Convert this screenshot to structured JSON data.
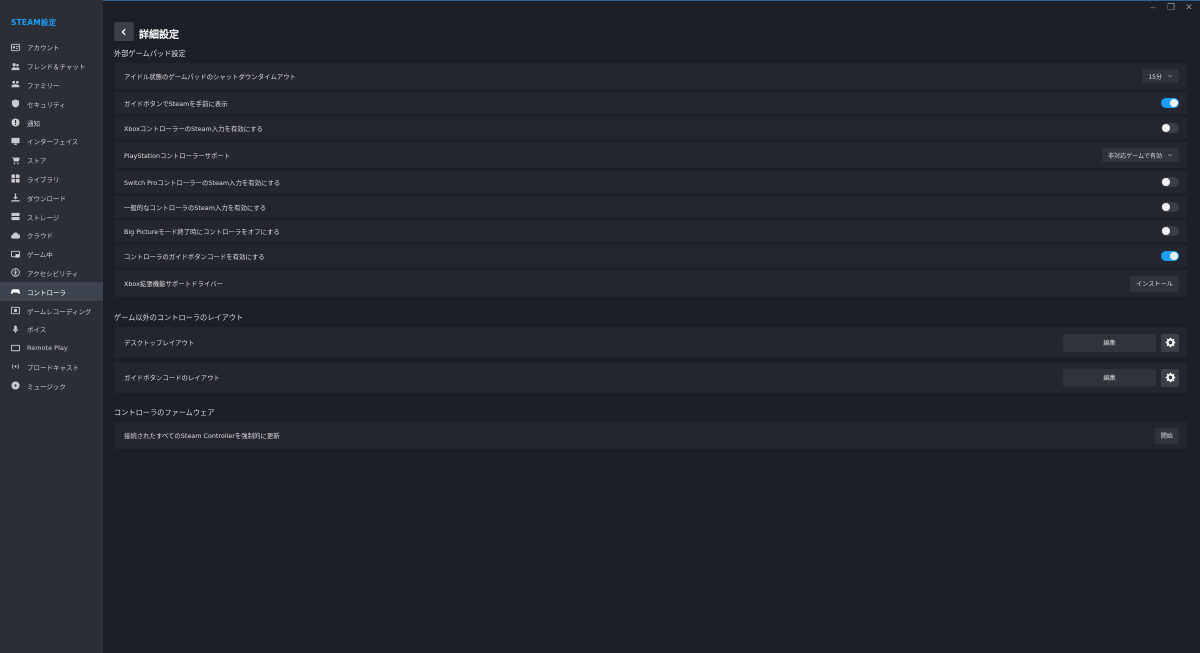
{
  "sidebar": {
    "title": "STEAM設定",
    "items": [
      {
        "label": "アカウント",
        "icon": "account-icon"
      },
      {
        "label": "フレンド＆チャット",
        "icon": "friends-icon"
      },
      {
        "label": "ファミリー",
        "icon": "family-icon"
      },
      {
        "label": "セキュリティ",
        "icon": "shield-icon"
      },
      {
        "label": "通知",
        "icon": "notification-icon"
      },
      {
        "label": "インターフェイス",
        "icon": "monitor-icon"
      },
      {
        "label": "ストア",
        "icon": "cart-icon"
      },
      {
        "label": "ライブラリ",
        "icon": "grid-icon"
      },
      {
        "label": "ダウンロード",
        "icon": "download-icon"
      },
      {
        "label": "ストレージ",
        "icon": "storage-icon"
      },
      {
        "label": "クラウド",
        "icon": "cloud-icon"
      },
      {
        "label": "ゲーム中",
        "icon": "in-game-icon"
      },
      {
        "label": "アクセシビリティ",
        "icon": "accessibility-icon"
      },
      {
        "label": "コントローラ",
        "icon": "gamepad-icon",
        "active": true
      },
      {
        "label": "ゲームレコーディング",
        "icon": "recording-icon"
      },
      {
        "label": "ボイス",
        "icon": "microphone-icon"
      },
      {
        "label": "Remote Play",
        "icon": "remote-play-icon"
      },
      {
        "label": "ブロードキャスト",
        "icon": "broadcast-icon"
      },
      {
        "label": "ミュージック",
        "icon": "music-icon"
      }
    ]
  },
  "header": {
    "title": "詳細設定"
  },
  "sections": {
    "gamepad": {
      "title": "外部ゲームパッド設定",
      "rows": [
        {
          "label": "アイドル状態のゲームパッドのシャットダウンタイムアウト",
          "control": "dropdown",
          "value": "15分"
        },
        {
          "label": "ガイドボタンでSteamを手前に表示",
          "control": "toggle",
          "on": true
        },
        {
          "label": "XboxコントローラーのSteam入力を有効にする",
          "control": "toggle",
          "on": false
        },
        {
          "label": "PlayStationコントローラーサポート",
          "control": "dropdown",
          "value": "非対応ゲームで有効"
        },
        {
          "label": "Switch ProコントローラーのSteam入力を有効にする",
          "control": "toggle",
          "on": false
        },
        {
          "label": "一般的なコントローラのSteam入力を有効にする",
          "control": "toggle",
          "on": false
        },
        {
          "label": "Big Pictureモード終了時にコントローラをオフにする",
          "control": "toggle",
          "on": false
        },
        {
          "label": "コントローラのガイドボタンコードを有効にする",
          "control": "toggle",
          "on": true
        },
        {
          "label": "Xbox拡張機能サポートドライバー",
          "control": "button",
          "value": "インストール"
        }
      ]
    },
    "layouts": {
      "title": "ゲーム以外のコントローラのレイアウト",
      "rows": [
        {
          "label": "デスクトップレイアウト",
          "button": "編集"
        },
        {
          "label": "ガイドボタンコードのレイアウト",
          "button": "編集"
        }
      ]
    },
    "firmware": {
      "title": "コントローラのファームウェア",
      "rows": [
        {
          "label": "接続されたすべてのSteam Controllerを強制的に更新",
          "button": "開始"
        }
      ]
    }
  },
  "colors": {
    "accent": "#1a9fff",
    "background": "#1b1f28",
    "sidebar": "#2b2e34",
    "row": "#23262e"
  }
}
